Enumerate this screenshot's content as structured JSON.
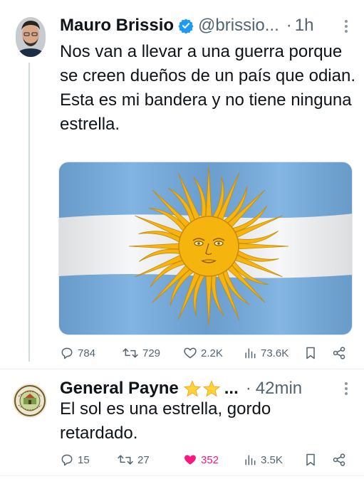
{
  "tweet1": {
    "display_name": "Mauro Brissio",
    "handle": "@brissio...",
    "separator": "·",
    "time": "1h",
    "text": "Nos van a llevar a una guerra porque se creen dueños de un país que odian.\nEsta es mi bandera y no tiene ninguna estrella.",
    "media": "argentine-flag-image",
    "stats": {
      "replies": "784",
      "reposts": "729",
      "likes": "2.2K",
      "views": "73.6K"
    }
  },
  "tweet2": {
    "display_name": "General Payne",
    "name_suffix": "...",
    "separator": "·",
    "time": "42min",
    "text": "El sol es una estrella, gordo retardado.",
    "stats": {
      "replies": "15",
      "reposts": "27",
      "likes": "352",
      "views": "3.5K"
    }
  },
  "colors": {
    "verified": "#1d9bf0",
    "like_active": "#f91880",
    "muted_text": "#536471",
    "flag_blue": "#74acdf",
    "sun_gold": "#f6b40e"
  },
  "icons": [
    "verified-badge-icon",
    "more-icon",
    "reply-icon",
    "repost-icon",
    "like-icon",
    "views-icon",
    "bookmark-icon",
    "share-icon",
    "star-emoji-icon"
  ]
}
